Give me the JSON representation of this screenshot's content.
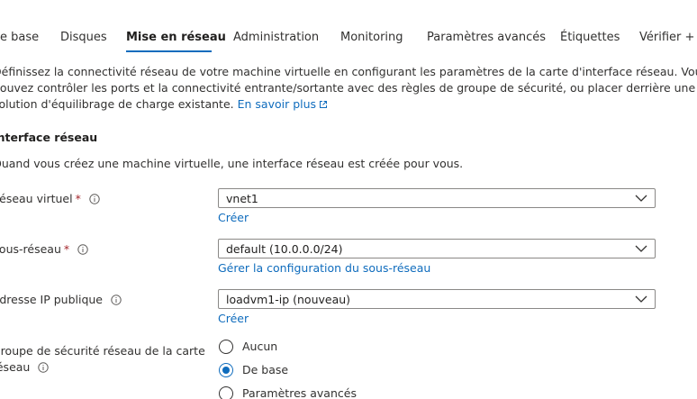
{
  "tabs": [
    {
      "label": "De base"
    },
    {
      "label": "Disques"
    },
    {
      "label": "Mise en réseau",
      "active": true
    },
    {
      "label": "Administration"
    },
    {
      "label": "Monitoring"
    },
    {
      "label": "Paramètres avancés"
    },
    {
      "label": "Étiquettes"
    },
    {
      "label": "Vérifier + c"
    }
  ],
  "intro": {
    "line1": "Définissez la connectivité réseau de votre machine virtuelle en configurant les paramètres de la carte d'interface réseau. Vous",
    "line2": "pouvez contrôler les ports et la connectivité entrante/sortante avec des règles de groupe de sécurité, ou placer derrière une",
    "line3": "solution d'équilibrage de charge existante.",
    "learn_more": "En savoir plus"
  },
  "section": {
    "title": "Interface réseau",
    "description": "Quand vous créez une machine virtuelle, une interface réseau est créée pour vous."
  },
  "fields": {
    "vnet": {
      "label": "Réseau virtuel",
      "value": "vnet1",
      "link": "Créer"
    },
    "subnet": {
      "label": "Sous-réseau",
      "value": "default (10.0.0.0/24)",
      "link": "Gérer la configuration du sous-réseau"
    },
    "public_ip": {
      "label": "Adresse IP publique",
      "value": "loadvm1-ip (nouveau)",
      "link": "Créer"
    }
  },
  "nsg": {
    "label_line1": "Groupe de sécurité réseau de la carte",
    "label_line2": "réseau",
    "options": [
      {
        "label": "Aucun",
        "selected": false
      },
      {
        "label": "De base",
        "selected": true
      },
      {
        "label": "Paramètres avancés",
        "selected": false
      }
    ]
  },
  "required_marker": "*",
  "colors": {
    "accent": "#0f6cbd",
    "required": "#a4262c",
    "text": "#323130"
  }
}
